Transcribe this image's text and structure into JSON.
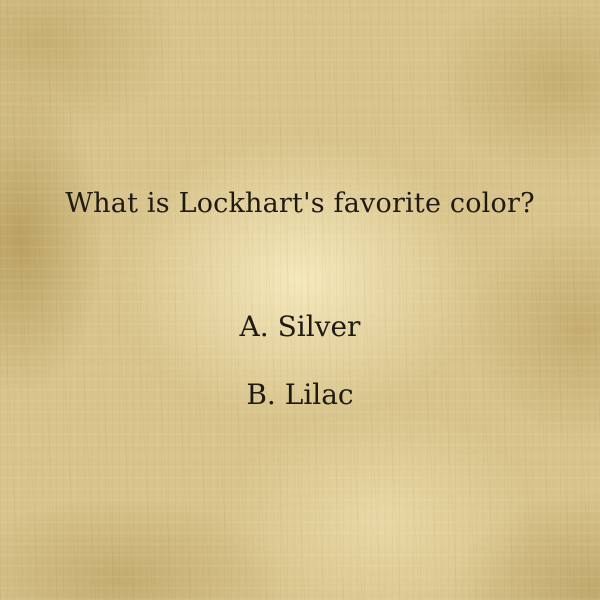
{
  "quiz": {
    "question": "What is Lockhart's favorite color?",
    "options": [
      {
        "text": "A. Silver"
      },
      {
        "text": "B. Lilac"
      }
    ]
  },
  "colors": {
    "text": "#1e1a12",
    "parchment": "#d8c48c"
  }
}
